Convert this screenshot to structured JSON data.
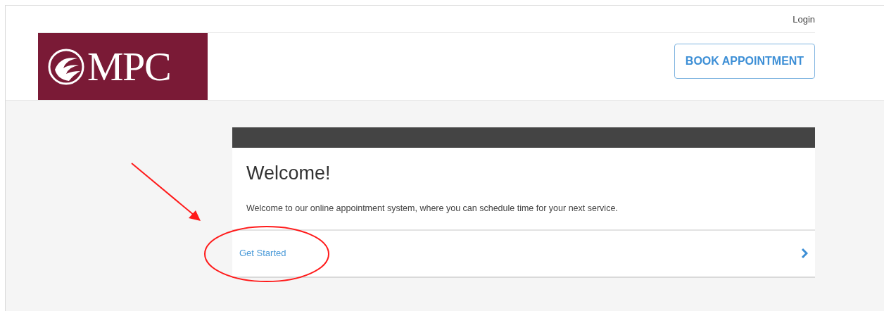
{
  "header": {
    "login_link": "Login",
    "logo_text": "MPC",
    "book_button": "BOOK APPOINTMENT"
  },
  "welcome_card": {
    "heading": "Welcome!",
    "description": "Welcome to our online appointment system, where you can schedule time for your next service.",
    "action_link": "Get Started"
  }
}
